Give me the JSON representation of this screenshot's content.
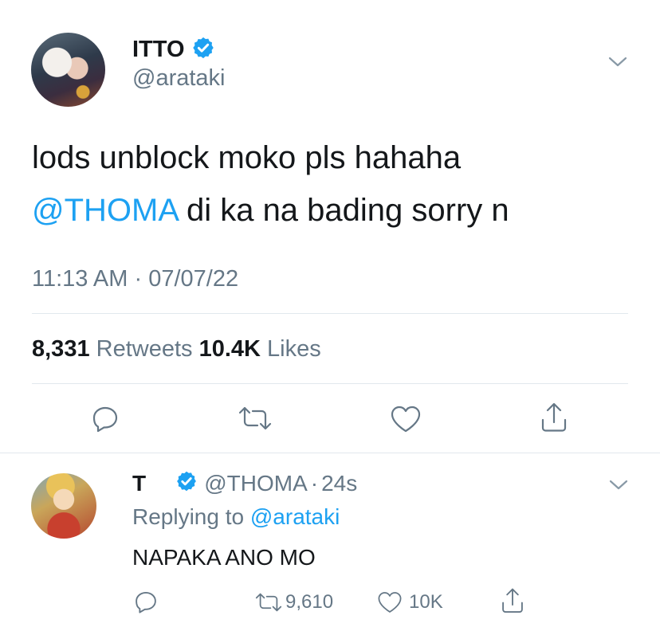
{
  "tweet": {
    "display_name": "ITTO",
    "handle": "@arataki",
    "text_line1": "lods unblock moko pls hahaha",
    "mention": "@THOMA",
    "text_line2_rest": " di ka na bading sorry n",
    "time": "11:13 AM",
    "separator": "·",
    "date": "07/07/22",
    "retweets_count": "8,331",
    "retweets_label": "Retweets",
    "likes_count": "10.4K",
    "likes_label": "Likes",
    "icons": [
      "chevron-down-icon",
      "reply-icon",
      "retweet-icon",
      "like-icon",
      "share-icon",
      "verified-icon"
    ]
  },
  "reply": {
    "display_name": "T",
    "handle": "@THOMA",
    "separator": "·",
    "age": "24s",
    "replying_prefix": "Replying to ",
    "replying_to": "@arataki",
    "text": "NAPAKA ANO MO",
    "retweet_count": "9,610",
    "like_count": "10K"
  },
  "colors": {
    "accent": "#1da1f2",
    "verified": "#1da1f2",
    "muted": "#657786",
    "divider": "#e1e8ed"
  }
}
